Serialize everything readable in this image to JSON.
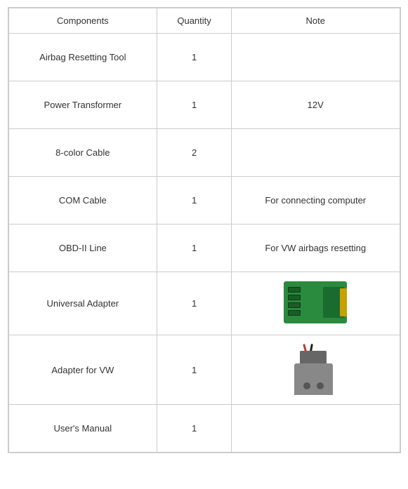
{
  "table": {
    "headers": {
      "components": "Components",
      "quantity": "Quantity",
      "note": "Note"
    },
    "rows": [
      {
        "component": "Airbag Resetting Tool",
        "quantity": "1",
        "note": ""
      },
      {
        "component": "Power Transformer",
        "quantity": "1",
        "note": "12V"
      },
      {
        "component": "8-color Cable",
        "quantity": "2",
        "note": ""
      },
      {
        "component": "COM Cable",
        "quantity": "1",
        "note": "For connecting computer"
      },
      {
        "component": "OBD-II Line",
        "quantity": "1",
        "note": "For VW airbags resetting"
      },
      {
        "component": "Universal Adapter",
        "quantity": "1",
        "note": "image-pcb"
      },
      {
        "component": "Adapter for VW",
        "quantity": "1",
        "note": "image-adapter"
      },
      {
        "component": "User's Manual",
        "quantity": "1",
        "note": ""
      }
    ]
  }
}
